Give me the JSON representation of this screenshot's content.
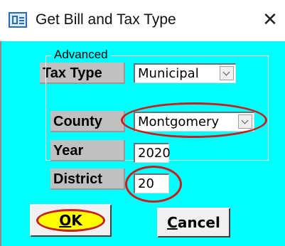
{
  "window": {
    "title": "Get Bill and Tax Type",
    "close_glyph": "✕"
  },
  "form": {
    "tax_type": {
      "label": "Tax Type",
      "value": "Municipal"
    },
    "advanced_group_label": "Advanced",
    "county": {
      "label": "County",
      "value": "Montgomery"
    },
    "year": {
      "label": "Year",
      "value": "2020"
    },
    "district": {
      "label": "District",
      "value": "20"
    }
  },
  "buttons": {
    "ok": {
      "mnemonic": "O",
      "rest": "K"
    },
    "cancel": {
      "mnemonic": "C",
      "rest": "ancel"
    }
  },
  "colors": {
    "client_background": "#00ffff",
    "label_background": "#c0c0c0",
    "annotation_red": "#c81e1e",
    "ok_highlight": "#ffff00"
  },
  "icons": [
    "app-window-icon",
    "close-icon",
    "chevron-down-icon"
  ]
}
